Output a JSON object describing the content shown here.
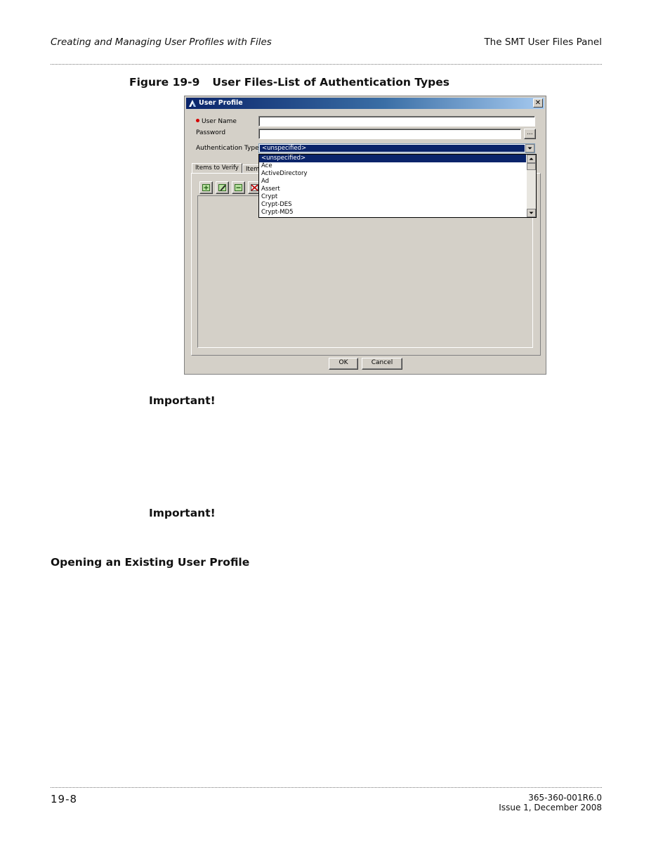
{
  "header": {
    "left": "Creating and Managing User Profiles with Files",
    "right": "The SMT User Files Panel"
  },
  "figure": {
    "number": "Figure 19-9",
    "title": "User Files-List of Authentication Types"
  },
  "dialog": {
    "title": "User Profile",
    "close_glyph": "✕",
    "user_name_label": "User Name",
    "password_label": "Password",
    "browse_label": "...",
    "auth_type_label": "Authentication Type",
    "auth_type_value": "<unspecified>",
    "auth_options": [
      "<unspecified>",
      "Ace",
      "ActiveDirectory",
      "Ad",
      "Assert",
      "Crypt",
      "Crypt-DES",
      "Crypt-MD5"
    ],
    "tabs": [
      "Items to Verify",
      "Item"
    ],
    "ok_label": "OK",
    "cancel_label": "Cancel",
    "icons": [
      "add-icon",
      "edit-icon",
      "remove-icon",
      "delete-icon"
    ]
  },
  "body": {
    "important_1": "Important!",
    "important_2": "Important!",
    "section_heading": "Opening an Existing User Profile"
  },
  "footer": {
    "page": "19-8",
    "doc_number": "365-360-001R6.0",
    "issue": "Issue 1, December 2008"
  }
}
